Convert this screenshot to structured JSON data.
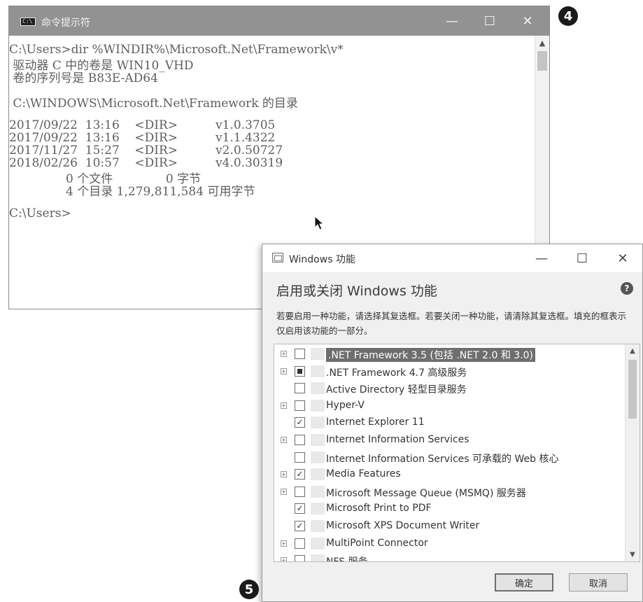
{
  "cmd": {
    "title": "命令提示符",
    "icon_label": "C:\\",
    "controls": {
      "minimize": "—",
      "maximize": "☐",
      "close": "✕"
    },
    "lines": [
      "C:\\Users>dir %WINDIR%\\Microsoft.Net\\Framework\\v*",
      " 驱动器 C 中的卷是 WIN10_VHD",
      " 卷的序列号是 B83E-AD64",
      "",
      " C:\\WINDOWS\\Microsoft.Net\\Framework 的目录",
      "",
      "2017/09/22  13:16    <DIR>          v1.0.3705",
      "2017/09/22  13:16    <DIR>          v1.1.4322",
      "2017/11/27  15:27    <DIR>          v2.0.50727",
      "2018/02/26  10:57    <DIR>          v4.0.30319",
      "               0 个文件              0 字节",
      "               4 个目录 1,279,811,584 可用字节",
      "",
      "C:\\Users>"
    ]
  },
  "markers": {
    "step4": "4",
    "step5": "5"
  },
  "dialog": {
    "title": "Windows 功能",
    "controls": {
      "minimize": "—",
      "maximize": "☐",
      "close": "✕"
    },
    "heading": "启用或关闭 Windows 功能",
    "help": "?",
    "description": "若要启用一种功能，请选择其复选框。若要关闭一种功能，请清除其复选框。填充的框表示仅启用该功能的一部分。",
    "features": [
      {
        "label": ".NET Framework 3.5 (包括 .NET 2.0 和 3.0)",
        "expandable": true,
        "state": "unchecked",
        "selected": true
      },
      {
        "label": ".NET Framework 4.7 高级服务",
        "expandable": true,
        "state": "partial",
        "selected": false
      },
      {
        "label": "Active Directory 轻型目录服务",
        "expandable": false,
        "state": "unchecked",
        "selected": false
      },
      {
        "label": "Hyper-V",
        "expandable": true,
        "state": "unchecked",
        "selected": false
      },
      {
        "label": "Internet Explorer 11",
        "expandable": false,
        "state": "checked",
        "selected": false
      },
      {
        "label": "Internet Information Services",
        "expandable": true,
        "state": "unchecked",
        "selected": false
      },
      {
        "label": "Internet Information Services 可承载的 Web 核心",
        "expandable": false,
        "state": "unchecked",
        "selected": false
      },
      {
        "label": "Media Features",
        "expandable": true,
        "state": "checked",
        "selected": false
      },
      {
        "label": "Microsoft Message Queue (MSMQ) 服务器",
        "expandable": true,
        "state": "unchecked",
        "selected": false
      },
      {
        "label": "Microsoft Print to PDF",
        "expandable": false,
        "state": "checked",
        "selected": false
      },
      {
        "label": "Microsoft XPS Document Writer",
        "expandable": false,
        "state": "checked",
        "selected": false
      },
      {
        "label": "MultiPoint Connector",
        "expandable": true,
        "state": "unchecked",
        "selected": false
      },
      {
        "label": "NFS 服务",
        "expandable": true,
        "state": "unchecked",
        "selected": false
      }
    ],
    "ok_label": "确定",
    "cancel_label": "取消"
  }
}
